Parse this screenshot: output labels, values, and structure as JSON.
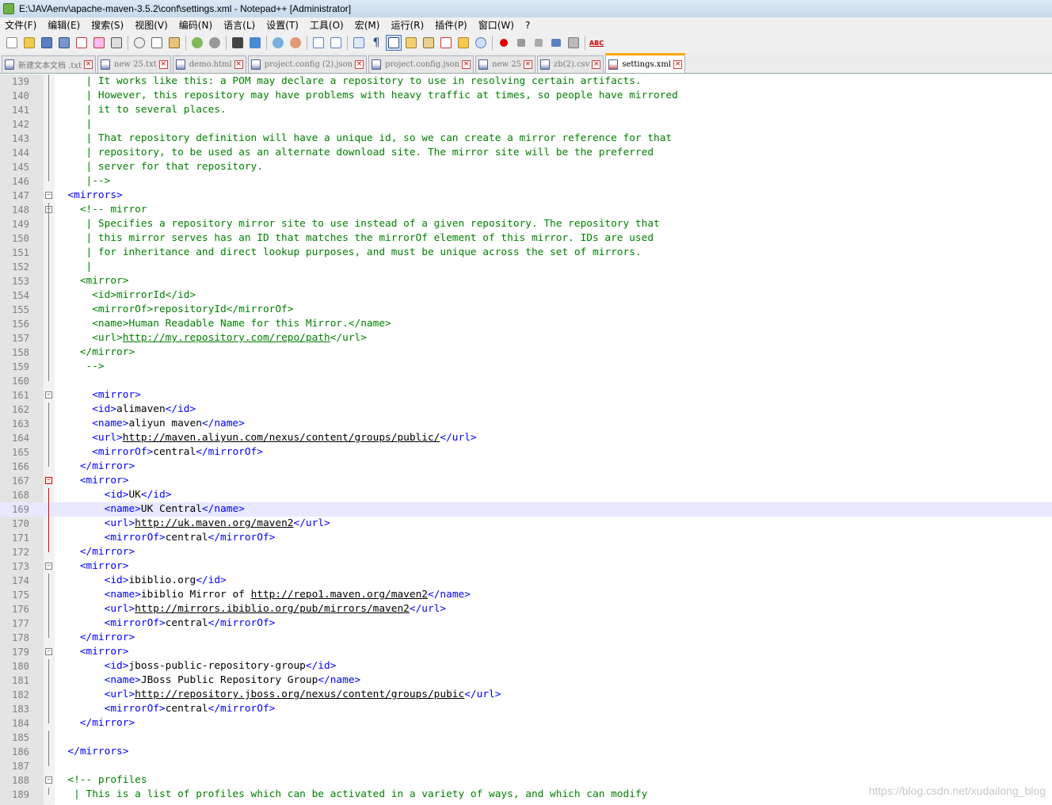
{
  "window": {
    "title": "E:\\JAVAenv\\apache-maven-3.5.2\\conf\\settings.xml - Notepad++ [Administrator]"
  },
  "menu": [
    "文件(F)",
    "编辑(E)",
    "搜索(S)",
    "视图(V)",
    "编码(N)",
    "语言(L)",
    "设置(T)",
    "工具(O)",
    "宏(M)",
    "运行(R)",
    "插件(P)",
    "窗口(W)",
    "?"
  ],
  "toolbar": {
    "spell_label": "ABC"
  },
  "tabs": [
    {
      "label": "新建文本文档 .txt",
      "icon": "document-icon",
      "edited": false
    },
    {
      "label": "new 25.txt",
      "icon": "document-icon",
      "edited": false
    },
    {
      "label": "demo.html",
      "icon": "document-icon",
      "edited": false
    },
    {
      "label": "project.config (2).json",
      "icon": "document-icon",
      "edited": false
    },
    {
      "label": "project.config.json",
      "icon": "document-icon",
      "edited": false
    },
    {
      "label": "new 25",
      "icon": "document-icon",
      "edited": false
    },
    {
      "label": "zb(2).csv",
      "icon": "document-icon",
      "edited": false
    },
    {
      "label": "settings.xml",
      "icon": "document-icon",
      "edited": true,
      "active": true
    }
  ],
  "editor": {
    "current_line": 169,
    "lines": [
      {
        "n": "139",
        "parts": [
          [
            "c",
            "     | It works like this: a POM may declare a repository to use in resolving certain artifacts."
          ]
        ]
      },
      {
        "n": "140",
        "parts": [
          [
            "c",
            "     | However, this repository may have problems with heavy traffic at times, so people have mirrored"
          ]
        ]
      },
      {
        "n": "141",
        "parts": [
          [
            "c",
            "     | it to several places."
          ]
        ]
      },
      {
        "n": "142",
        "parts": [
          [
            "c",
            "     |"
          ]
        ]
      },
      {
        "n": "143",
        "parts": [
          [
            "c",
            "     | That repository definition will have a unique id, so we can create a mirror reference for that"
          ]
        ]
      },
      {
        "n": "144",
        "parts": [
          [
            "c",
            "     | repository, to be used as an alternate download site. The mirror site will be the preferred"
          ]
        ]
      },
      {
        "n": "145",
        "parts": [
          [
            "c",
            "     | server for that repository."
          ]
        ]
      },
      {
        "n": "146",
        "parts": [
          [
            "c",
            "     |-->"
          ]
        ]
      },
      {
        "n": "147",
        "parts": [
          [
            "t",
            "  <mirrors>"
          ]
        ]
      },
      {
        "n": "148",
        "parts": [
          [
            "c",
            "    <!-- mirror"
          ]
        ]
      },
      {
        "n": "149",
        "parts": [
          [
            "c",
            "     | Specifies a repository mirror site to use instead of a given repository. The repository that"
          ]
        ]
      },
      {
        "n": "150",
        "parts": [
          [
            "c",
            "     | this mirror serves has an ID that matches the mirrorOf element of this mirror. IDs are used"
          ]
        ]
      },
      {
        "n": "151",
        "parts": [
          [
            "c",
            "     | for inheritance and direct lookup purposes, and must be unique across the set of mirrors."
          ]
        ]
      },
      {
        "n": "152",
        "parts": [
          [
            "c",
            "     |"
          ]
        ]
      },
      {
        "n": "153",
        "parts": [
          [
            "c",
            "    <mirror>"
          ]
        ]
      },
      {
        "n": "154",
        "parts": [
          [
            "c",
            "      <id>mirrorId</id>"
          ]
        ]
      },
      {
        "n": "155",
        "parts": [
          [
            "c",
            "      <mirrorOf>repositoryId</mirrorOf>"
          ]
        ]
      },
      {
        "n": "156",
        "parts": [
          [
            "c",
            "      <name>Human Readable Name for this Mirror.</name>"
          ]
        ]
      },
      {
        "n": "157",
        "parts": [
          [
            "c",
            "      <url>"
          ],
          [
            "cu",
            "http://my.repository.com/repo/path"
          ],
          [
            "c",
            "</url>"
          ]
        ]
      },
      {
        "n": "158",
        "parts": [
          [
            "c",
            "    </mirror>"
          ]
        ]
      },
      {
        "n": "159",
        "parts": [
          [
            "c",
            "     -->"
          ]
        ]
      },
      {
        "n": "160",
        "parts": [
          [
            "",
            "      "
          ]
        ]
      },
      {
        "n": "161",
        "parts": [
          [
            "t",
            "      <mirror>"
          ]
        ]
      },
      {
        "n": "162",
        "parts": [
          [
            "t",
            "      <id>"
          ],
          [
            "",
            "alimaven"
          ],
          [
            "t",
            "</id>"
          ]
        ]
      },
      {
        "n": "163",
        "parts": [
          [
            "t",
            "      <name>"
          ],
          [
            "",
            "aliyun maven"
          ],
          [
            "t",
            "</name>"
          ]
        ]
      },
      {
        "n": "164",
        "parts": [
          [
            "t",
            "      <url>"
          ],
          [
            "u",
            "http://maven.aliyun.com/nexus/content/groups/public/"
          ],
          [
            "t",
            "</url>"
          ]
        ]
      },
      {
        "n": "165",
        "parts": [
          [
            "t",
            "      <mirrorOf>"
          ],
          [
            "",
            "central"
          ],
          [
            "t",
            "</mirrorOf>"
          ]
        ]
      },
      {
        "n": "166",
        "parts": [
          [
            "t",
            "    </mirror>"
          ]
        ]
      },
      {
        "n": "167",
        "parts": [
          [
            "t",
            "    <mirror>"
          ]
        ]
      },
      {
        "n": "168",
        "parts": [
          [
            "t",
            "        <id>"
          ],
          [
            "",
            "UK"
          ],
          [
            "t",
            "</id>"
          ]
        ]
      },
      {
        "n": "169",
        "parts": [
          [
            "t",
            "        <name>"
          ],
          [
            "",
            "UK Central"
          ],
          [
            "t",
            "</name>"
          ]
        ]
      },
      {
        "n": "170",
        "parts": [
          [
            "t",
            "        <url>"
          ],
          [
            "u",
            "http://uk.maven.org/maven2"
          ],
          [
            "t",
            "</url>"
          ]
        ]
      },
      {
        "n": "171",
        "parts": [
          [
            "t",
            "        <mirrorOf>"
          ],
          [
            "",
            "central"
          ],
          [
            "t",
            "</mirrorOf>"
          ]
        ]
      },
      {
        "n": "172",
        "parts": [
          [
            "t",
            "    </mirror>"
          ]
        ]
      },
      {
        "n": "173",
        "parts": [
          [
            "t",
            "    <mirror>"
          ]
        ]
      },
      {
        "n": "174",
        "parts": [
          [
            "t",
            "        <id>"
          ],
          [
            "",
            "ibiblio.org"
          ],
          [
            "t",
            "</id>"
          ]
        ]
      },
      {
        "n": "175",
        "parts": [
          [
            "t",
            "        <name>"
          ],
          [
            "",
            "ibiblio Mirror of "
          ],
          [
            "u",
            "http://repo1.maven.org/maven2"
          ],
          [
            "t",
            "</name>"
          ]
        ]
      },
      {
        "n": "176",
        "parts": [
          [
            "t",
            "        <url>"
          ],
          [
            "u",
            "http://mirrors.ibiblio.org/pub/mirrors/maven2"
          ],
          [
            "t",
            "</url>"
          ]
        ]
      },
      {
        "n": "177",
        "parts": [
          [
            "t",
            "        <mirrorOf>"
          ],
          [
            "",
            "central"
          ],
          [
            "t",
            "</mirrorOf>"
          ]
        ]
      },
      {
        "n": "178",
        "parts": [
          [
            "t",
            "    </mirror>"
          ]
        ]
      },
      {
        "n": "179",
        "parts": [
          [
            "t",
            "    <mirror>"
          ]
        ]
      },
      {
        "n": "180",
        "parts": [
          [
            "t",
            "        <id>"
          ],
          [
            "",
            "jboss-public-repository-group"
          ],
          [
            "t",
            "</id>"
          ]
        ]
      },
      {
        "n": "181",
        "parts": [
          [
            "t",
            "        <name>"
          ],
          [
            "",
            "JBoss Public Repository Group"
          ],
          [
            "t",
            "</name>"
          ]
        ]
      },
      {
        "n": "182",
        "parts": [
          [
            "t",
            "        <url>"
          ],
          [
            "u",
            "http://repository.jboss.org/nexus/content/groups/pubic"
          ],
          [
            "t",
            "</url>"
          ]
        ]
      },
      {
        "n": "183",
        "parts": [
          [
            "t",
            "        <mirrorOf>"
          ],
          [
            "",
            "central"
          ],
          [
            "t",
            "</mirrorOf>"
          ]
        ]
      },
      {
        "n": "184",
        "parts": [
          [
            "t",
            "    </mirror>"
          ]
        ]
      },
      {
        "n": "185",
        "parts": [
          [
            "",
            ""
          ]
        ]
      },
      {
        "n": "186",
        "parts": [
          [
            "t",
            "  </mirrors>"
          ]
        ]
      },
      {
        "n": "187",
        "parts": [
          [
            "",
            ""
          ]
        ]
      },
      {
        "n": "188",
        "parts": [
          [
            "c",
            "  <!-- profiles"
          ]
        ]
      },
      {
        "n": "189",
        "parts": [
          [
            "c",
            "   | This is a list of profiles which can be activated in a variety of ways, and which can modify"
          ]
        ]
      }
    ]
  },
  "watermark": "https://blog.csdn.net/xudailong_blog"
}
